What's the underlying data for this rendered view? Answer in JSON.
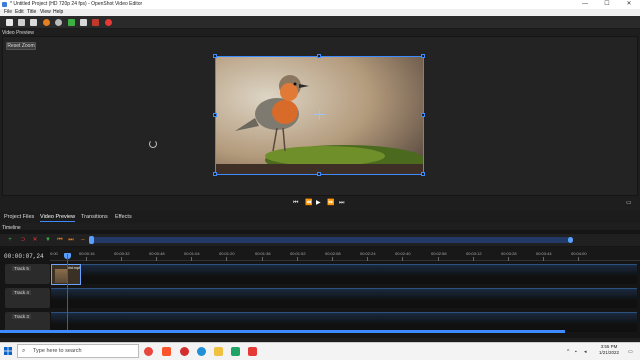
{
  "window": {
    "title": "* Untitled Project (HD 720p 24 fps) - OpenShot Video Editor",
    "controls": [
      "—",
      "☐",
      "✕"
    ]
  },
  "menu": [
    "File",
    "Edit",
    "Title",
    "View",
    "Help"
  ],
  "toolbar_icons": [
    "new-file-icon",
    "open-file-icon",
    "save-icon",
    "undo-icon",
    "redo-icon",
    "add-files-icon",
    "profile-icon",
    "fullscreen-icon",
    "record-icon"
  ],
  "preview": {
    "label": "Video Preview",
    "reset_zoom": "Reset Zoom"
  },
  "playback_icons": [
    "jump-start-icon",
    "rewind-icon",
    "play-icon",
    "fast-forward-icon",
    "jump-end-icon"
  ],
  "tabs": [
    {
      "label": "Project Files",
      "active": false
    },
    {
      "label": "Video Preview",
      "active": true
    },
    {
      "label": "Transitions",
      "active": false
    },
    {
      "label": "Effects",
      "active": false
    }
  ],
  "timeline": {
    "label": "Timeline",
    "timecode": "00:00:07,24",
    "ruler": [
      "0:00",
      "00:00:16",
      "00:00:32",
      "00:00:48",
      "00:01:04",
      "00:01:20",
      "00:01:36",
      "00:01:52",
      "00:02:08",
      "00:02:24",
      "00:02:40",
      "00:02:56",
      "00:03:12",
      "00:03:28",
      "00:03:44",
      "00:04:00"
    ],
    "tracks": [
      "Track 5",
      "Track 4",
      "Track 3"
    ],
    "clip_label": "bird.mp4"
  },
  "taskbar": {
    "search_placeholder": "Type here to search",
    "time": "3:55 PM",
    "date": "1/21/2022"
  },
  "colors": {
    "accent": "#3d8bff",
    "playhead": "#dd2222"
  }
}
